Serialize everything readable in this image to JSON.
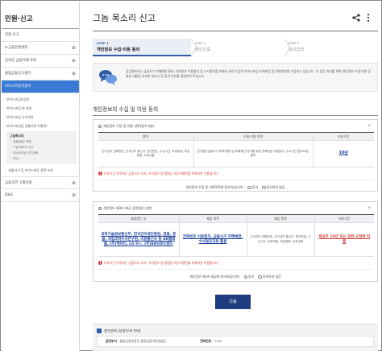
{
  "sidebar": {
    "title": "민원·신고",
    "items": [
      {
        "label": "민원 신고",
        "plus": ""
      },
      {
        "label": "e-금융민원센터",
        "plus": "⊕"
      },
      {
        "label": "상속인 금융거래 조회",
        "plus": "⊕"
      },
      {
        "label": "불법금융신고센터",
        "plus": "⊕"
      }
    ],
    "active": "보이스피싱지킴이",
    "subitems": [
      {
        "label": "보이스피싱지킴이",
        "chev": ""
      },
      {
        "label": "보이스피싱 현 실태",
        "chev": "›"
      },
      {
        "label": "보이스피싱 사기대응",
        "chev": "›"
      },
      {
        "label": "보이스피싱을 당했다면 어떻게?",
        "chev": "›"
      }
    ],
    "subsub_label": "그놈목소리",
    "subsub": [
      "· 성별 음성 이해",
      "· 그놈 목소리 신고",
      "· 보이스피싱 사기전화",
      "· FAQ"
    ],
    "after": [
      {
        "label": "· 대출사기 등 보이스피싱 관련 조회",
        "chev": ""
      }
    ],
    "bottom_items": [
      {
        "label": "금융조언 고충민원",
        "plus": "⊕"
      },
      {
        "label": "Q&A",
        "plus": "⊕"
      }
    ]
  },
  "page": {
    "title": "그놈 목소리 신고",
    "share_icon": "share-icon",
    "more_icon": "more-vertical-icon"
  },
  "steps": [
    {
      "num": "STEP 1",
      "label": "개인정보 수집·이용 동의"
    },
    {
      "num": "STEP 2",
      "label": "본인인증"
    },
    {
      "num": "STEP 3",
      "label": "정보입력"
    }
  ],
  "intro": {
    "icon": "chat-bubbles-icon",
    "text": "금감원에서는 금융사기 피해예방 홍보, 전화번호 이용중지 및 수사협조를 위해서 본인이 입력 보이스피싱 녹취파일 및 전화번호를 수집하고 있습니다. 또 업무 처리를 위한 개인정보 수집·이용 및 제공 내용을 자세히 읽으신 후 동의 여부를 결정하여 주십시오."
  },
  "section": {
    "title": "개인정보의 수집 및 이용 동의"
  },
  "consent1": {
    "head": "개인정보 수집 및 이용 내역(필수사항)",
    "toggle": "⊖",
    "headers": [
      "항목",
      "수집·이용 목적",
      "보유기간"
    ],
    "row": [
      "신고인의 전화번호, 신고인의 통신사, 명신번호, 수신시간, 녹취파일, 피싱종류, 녹취내용",
      "전기통신금융사기 피해 예방 및 피해확산 방지를 위한 전화번호 이용중지, 수사기관 협조요청, 홍보",
      "10년"
    ],
    "warning": "보유기간 이후에는 금융사고 조사, 수사협조 및 법령상 의무이행만을 위해서만 이용됩니다.",
    "agree_q": "개인정보 수집 및 이용목적에 동의하십니까?",
    "agree": "동의",
    "disagree": "동의하지 않음"
  },
  "consent2": {
    "head": "개인정보 제3자 제공 내역(필수사항)",
    "toggle": "⊖",
    "headers": [
      "제공받는 자",
      "제공 목적",
      "제공 항목",
      "보유기간"
    ],
    "row": [
      "과학기술정보통신부, 한국인터넷진흥원, 검찰, 경찰, 국립과학수사연구원, 이동통신사 등 SK텔레콤, (주)케이티, LG U+, (주)SK브로드밴드",
      "전화번호 이용중지, 금융사기 피해예방, 수사협조자료 활용",
      "신고인의 전화번호, 신고인의 통신사, 명신번호, 수신시간, 녹취파일, 피싱종류, 녹취내용",
      "제공후 10년 또는 관련 규정에 따름"
    ],
    "warning": "보유기간 이후에는 금융사고 조사, 수사협조 및 법령상 의무이행만을 위해서만 이용됩니다.",
    "agree_q": "개인정보 제3자 제공에 동의하십니까?",
    "agree": "동의",
    "disagree": "동의하지 않음"
  },
  "next_button": "다음",
  "info": {
    "title": "정보관리 담당부서 안내",
    "dept_label": "담당부서",
    "dept": "불법금융대응단 불법금융대응총괄팀",
    "phone_label": "전화번호",
    "phone": "1332"
  }
}
